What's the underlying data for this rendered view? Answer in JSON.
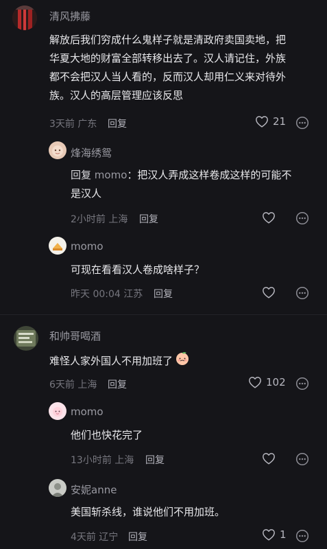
{
  "comments": [
    {
      "username": "清风拂藤",
      "lines": [
        "解放后我们穷成什么鬼样子就是清政府卖国卖地，把",
        "华夏大地的财富全部转移出去了。汉人请记住，外族",
        "都不会把汉人当人看的，反而汉人却用仁义来对待外",
        "族。汉人的高层管理应该反思"
      ],
      "time": "3天前",
      "location": "广东",
      "reply_label": "回复",
      "like_count": "21",
      "replies": [
        {
          "username": "烽海绣鸳",
          "reply_prefix": "回复",
          "reply_target": "momo",
          "lines": [
            "：把汉人弄成这样卷成这样的可能不",
            "是汉人"
          ],
          "time": "2小时前",
          "location": "上海",
          "reply_label": "回复",
          "like_count": ""
        },
        {
          "username": "momo",
          "lines": [
            "可现在看看汉人卷成啥样子？"
          ],
          "time": "昨天 00:04",
          "location": "江苏",
          "reply_label": "回复",
          "like_count": ""
        }
      ]
    },
    {
      "username": "和帅哥喝酒",
      "lines": [
        "难怪人家外国人不用加班了"
      ],
      "emoji": "peach-emoji",
      "time": "6天前",
      "location": "上海",
      "reply_label": "回复",
      "like_count": "102",
      "replies": [
        {
          "username": "momo",
          "lines": [
            "他们也快花完了"
          ],
          "time": "13小时前",
          "location": "上海",
          "reply_label": "回复",
          "like_count": ""
        },
        {
          "username": "安妮anne",
          "lines": [
            "美国斩杀线，谁说他们不用加班。"
          ],
          "time": "4天前",
          "location": "辽宁",
          "reply_label": "回复",
          "like_count": "1"
        }
      ]
    }
  ],
  "icons": {
    "like": "heart-outline-icon",
    "more": "more-dots-icon"
  },
  "colors": {
    "background": "#151519",
    "text": "#e9e9ec",
    "username": "#9a9aa2",
    "meta": "#77777f"
  }
}
